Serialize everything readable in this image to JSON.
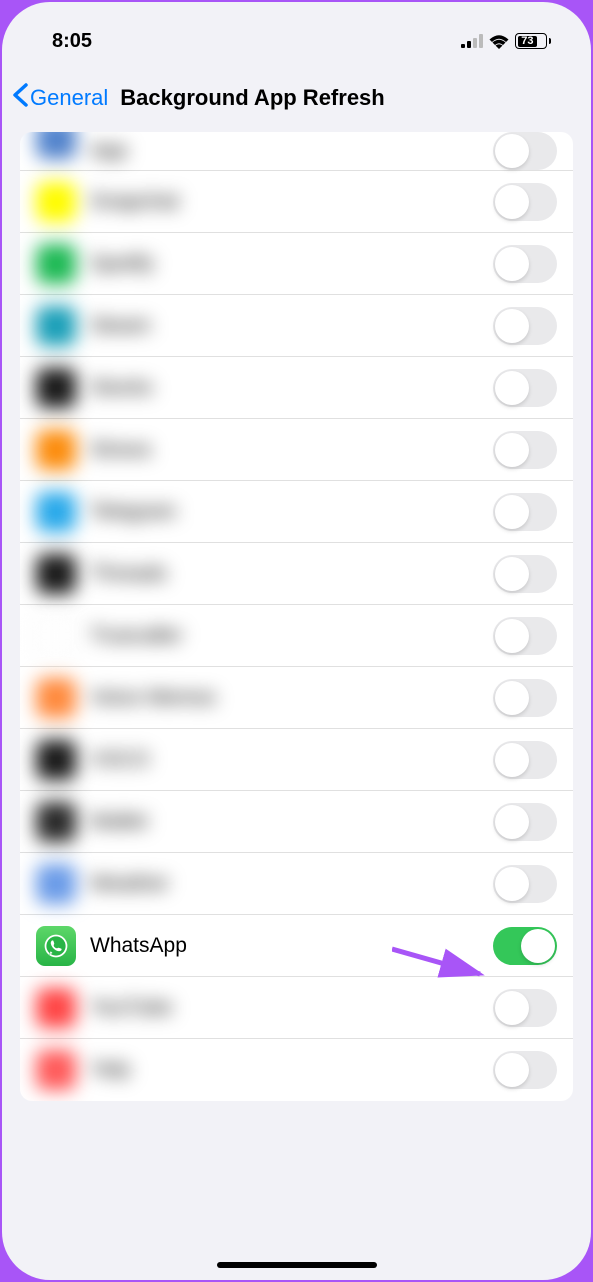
{
  "status": {
    "time": "8:05",
    "battery": "73"
  },
  "nav": {
    "back_label": "General",
    "title": "Background App Refresh"
  },
  "apps": [
    {
      "label": "App",
      "icon_color": "linear-gradient(135deg,#5b8dd6,#4a7bc4)",
      "enabled": false,
      "blurred": true,
      "partial_top": true
    },
    {
      "label": "Snapchat",
      "icon_color": "#fffc00",
      "enabled": false,
      "blurred": true
    },
    {
      "label": "Spotify",
      "icon_color": "#1db954",
      "enabled": false,
      "blurred": true
    },
    {
      "label": "Steam",
      "icon_color": "#1a9fb8",
      "enabled": false,
      "blurred": true
    },
    {
      "label": "Stocks",
      "icon_color": "#1a1a1a",
      "enabled": false,
      "blurred": true
    },
    {
      "label": "Strava",
      "icon_color": "#fc8c0c",
      "enabled": false,
      "blurred": true
    },
    {
      "label": "Telegram",
      "icon_color": "#29a9ea",
      "enabled": false,
      "blurred": true
    },
    {
      "label": "Threads",
      "icon_color": "#1a1a1a",
      "enabled": false,
      "blurred": true
    },
    {
      "label": "Truecaller",
      "icon_color": "#ffffff",
      "enabled": false,
      "blurred": true,
      "icon_border": true
    },
    {
      "label": "Voice Memos",
      "icon_color": "#ff8a3d",
      "enabled": false,
      "blurred": true
    },
    {
      "label": "VSCO",
      "icon_color": "#1a1a1a",
      "enabled": false,
      "blurred": true
    },
    {
      "label": "Wallet",
      "icon_color": "#2a2a2a",
      "enabled": false,
      "blurred": true
    },
    {
      "label": "Weather",
      "icon_color": "#6a9be8",
      "enabled": false,
      "blurred": true
    },
    {
      "label": "WhatsApp",
      "icon_color": "whatsapp",
      "enabled": true,
      "blurred": false
    },
    {
      "label": "YouTube",
      "icon_color": "#ff4545",
      "enabled": false,
      "blurred": true
    },
    {
      "label": "Yelp",
      "icon_color": "#ff5a5a",
      "enabled": false,
      "blurred": true
    }
  ]
}
